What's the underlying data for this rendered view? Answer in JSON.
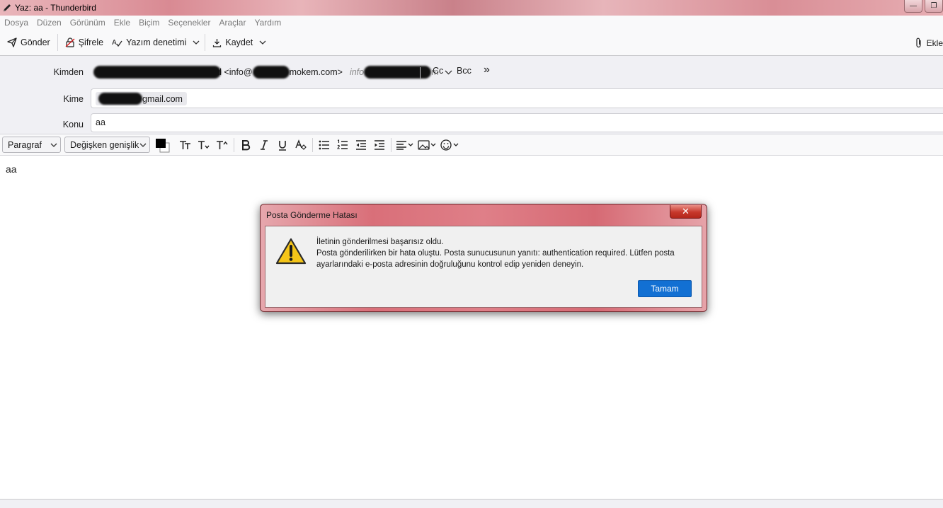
{
  "window": {
    "title": "Yaz: aa - Thunderbird",
    "minimize_glyph": "—",
    "restore_glyph": "❐"
  },
  "menu": [
    "Dosya",
    "Düzen",
    "Görünüm",
    "Ekle",
    "Biçim",
    "Seçenekler",
    "Araçlar",
    "Yardım"
  ],
  "toolbar": {
    "send_label": "Gönder",
    "encrypt_label": "Şifrele",
    "spell_label": "Yazım denetimi",
    "save_label": "Kaydet",
    "attach_label": "Ekle"
  },
  "header": {
    "from_label": "Kimden",
    "from_visible_suffix": "d <info@",
    "from_visible_domain": "mokem.com>",
    "from_alt_prefix": "info",
    "from_alt_suffix": "m",
    "cc_label": "Cc",
    "bcc_label": "Bcc",
    "more_glyph": "»",
    "to_label": "Kime",
    "to_visible": "gmail.com",
    "subject_label": "Konu",
    "subject_value": "aa"
  },
  "format": {
    "paragraph_select": "Paragraf",
    "font_select": "Değişken genişlik",
    "text_color": "#000000",
    "bg_color": "#ffffff"
  },
  "editor": {
    "body_text": "aa"
  },
  "dialog": {
    "title": "Posta Gönderme Hatası",
    "close_glyph": "✕",
    "line1": "İletinin gönderilmesi başarısız oldu.",
    "line2": "Posta gönderilirken bir hata oluştu. Posta sunucusunun yanıtı: authentication required. Lütfen posta ayarlarındaki e-posta adresinin doğruluğunu kontrol edip yeniden deneyin.",
    "ok_label": "Tamam",
    "accent": "#1270d3"
  }
}
